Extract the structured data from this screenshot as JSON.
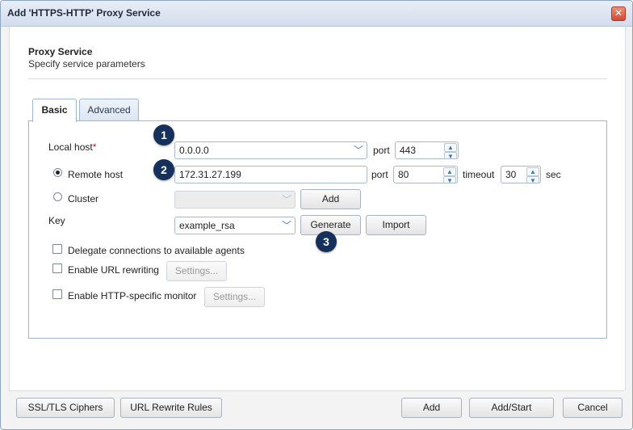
{
  "window": {
    "title": "Add 'HTTPS-HTTP' Proxy Service",
    "close_glyph": "✕"
  },
  "header": {
    "title": "Proxy Service",
    "subtitle": "Specify service parameters"
  },
  "tabs": [
    {
      "label": "Basic",
      "active": true
    },
    {
      "label": "Advanced",
      "active": false
    }
  ],
  "form": {
    "local_host": {
      "label": "Local host",
      "required_mark": "*",
      "value": "0.0.0.0"
    },
    "local_port": {
      "label": "port",
      "value": "443"
    },
    "remote_host": {
      "label": "Remote host",
      "value": "172.31.27.199",
      "selected": true
    },
    "remote_port": {
      "label": "port",
      "value": "80"
    },
    "timeout": {
      "label": "timeout",
      "value": "30",
      "unit": "sec"
    },
    "cluster": {
      "label": "Cluster",
      "value": "",
      "add_label": "Add"
    },
    "key": {
      "label": "Key",
      "value": "example_rsa",
      "generate_label": "Generate",
      "import_label": "Import"
    },
    "delegate": {
      "label": "Delegate connections to available agents",
      "checked": false
    },
    "url_rewriting": {
      "label": "Enable URL rewriting",
      "checked": false,
      "settings_label": "Settings..."
    },
    "http_monitor": {
      "label": "Enable HTTP-specific monitor",
      "checked": false,
      "settings_label": "Settings..."
    }
  },
  "markers": [
    "1",
    "2",
    "3"
  ],
  "footer": {
    "ssl_label": "SSL/TLS Ciphers",
    "url_rules_label": "URL Rewrite Rules",
    "add_label": "Add",
    "add_start_label": "Add/Start",
    "cancel_label": "Cancel"
  },
  "icons": {
    "chevron_down": "﹀",
    "spin_up": "▲",
    "spin_down": "▼"
  },
  "colors": {
    "marker_bg": "#16305c",
    "accent": "#3d76b3",
    "required": "#d01010"
  }
}
